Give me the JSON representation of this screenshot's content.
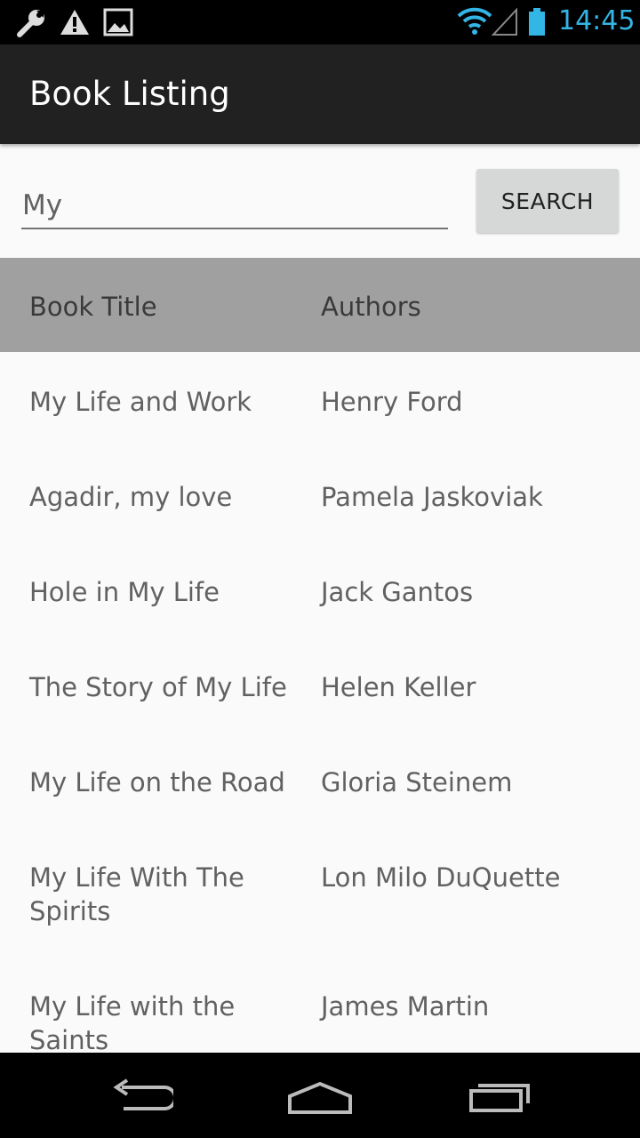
{
  "status_bar": {
    "time": "14:45",
    "icons": [
      "wrench-icon",
      "warning-icon",
      "image-icon",
      "wifi-icon",
      "signal-icon",
      "battery-icon"
    ],
    "accent_color": "#33b5e5"
  },
  "app_bar": {
    "title": "Book Listing",
    "background": "#212121"
  },
  "search": {
    "value": "My",
    "button_label": "SEARCH"
  },
  "table": {
    "headers": {
      "title": "Book Title",
      "authors": "Authors"
    },
    "rows": [
      {
        "title": "My Life and Work",
        "authors": "Henry Ford"
      },
      {
        "title": "Agadir, my love",
        "authors": "Pamela Jaskoviak"
      },
      {
        "title": "Hole in My Life",
        "authors": "Jack Gantos"
      },
      {
        "title": "The Story of My Life",
        "authors": "Helen Keller"
      },
      {
        "title": "My Life on the Road",
        "authors": "Gloria Steinem"
      },
      {
        "title": "My Life With The Spirits",
        "authors": "Lon Milo DuQuette"
      },
      {
        "title": "My Life with the Saints",
        "authors": "James Martin"
      }
    ]
  },
  "nav_bar": {
    "icons": [
      "back-icon",
      "home-icon",
      "recents-icon"
    ]
  }
}
